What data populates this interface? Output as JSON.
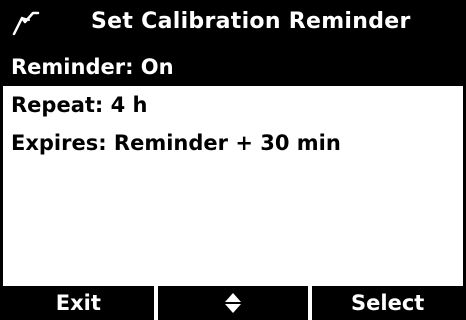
{
  "header": {
    "title": "Set Calibration Reminder",
    "icon": "probe-icon"
  },
  "menu": {
    "items": [
      {
        "label": "Reminder: On",
        "selected": true
      },
      {
        "label": "Repeat: 4 h",
        "selected": false
      },
      {
        "label": "Expires: Reminder + 30 min",
        "selected": false
      }
    ]
  },
  "softkeys": {
    "left_label": "Exit",
    "center_icon": "up-down-arrows-icon",
    "right_label": "Select"
  },
  "colors": {
    "background": "#ffffff",
    "foreground": "#000000",
    "inverse_text": "#ffffff"
  }
}
